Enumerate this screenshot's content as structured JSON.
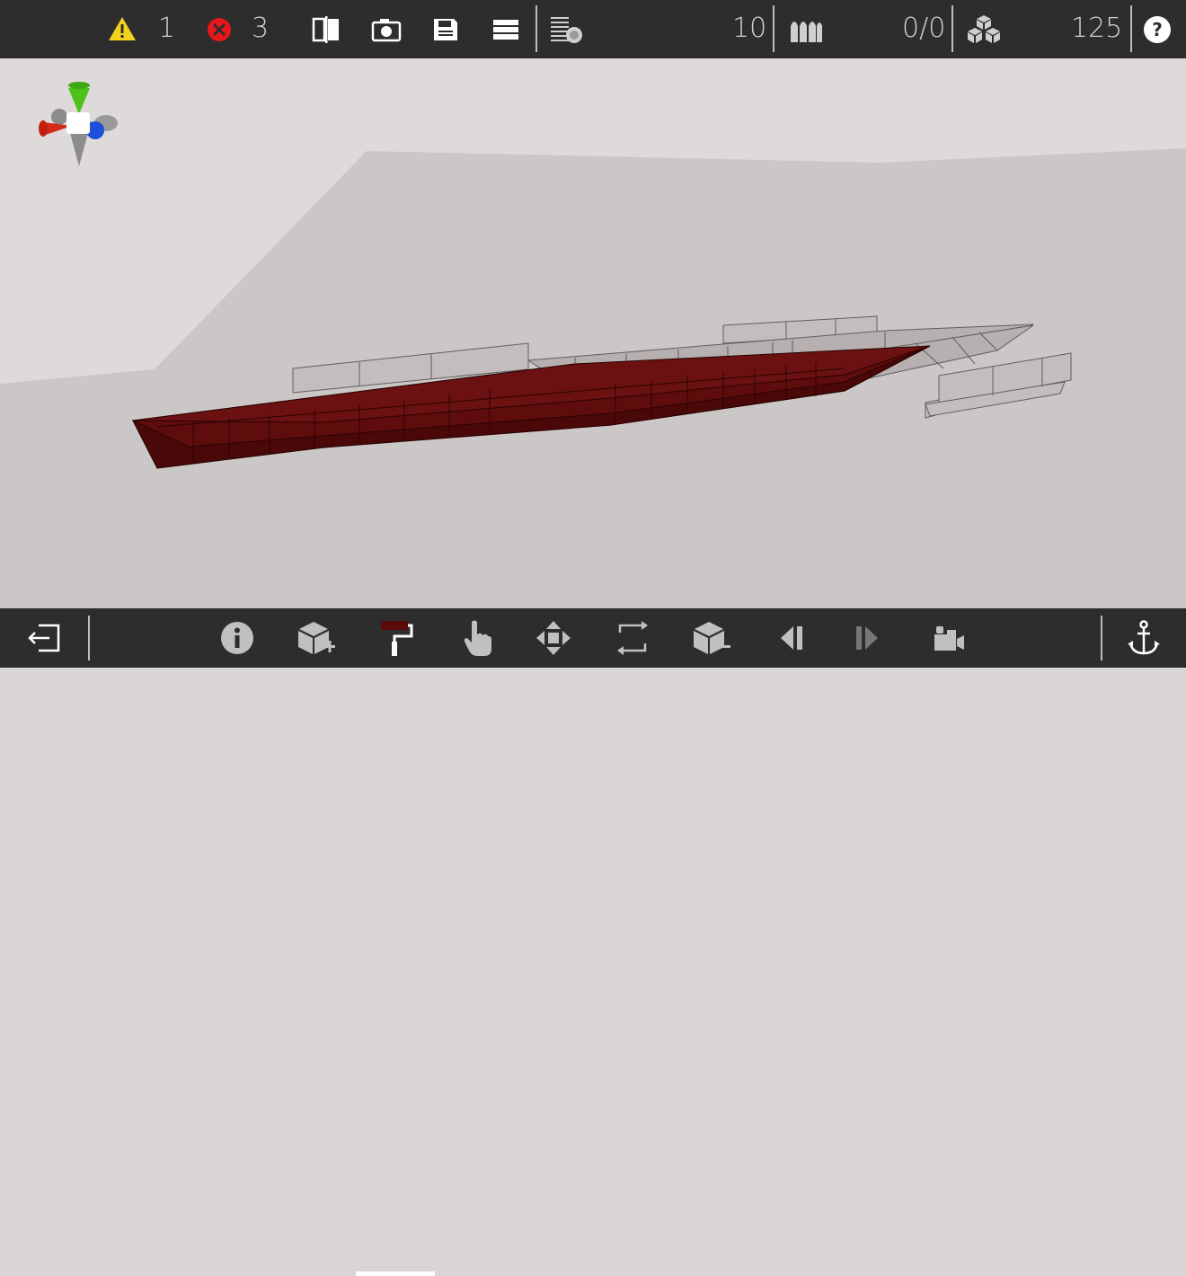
{
  "topbar": {
    "warnings_count": "1",
    "errors_count": "3",
    "ammo_count": "10",
    "ratio_count": "0/0",
    "blocks_count": "125",
    "icons": {
      "warning": "warning-icon",
      "error": "error-icon",
      "split_view": "split-view-icon",
      "screenshot": "camera-icon",
      "save": "save-icon",
      "menu": "menu-icon",
      "layers": "layers-icon",
      "ammo": "ammo-icon",
      "blocks": "blocks-icon",
      "help": "help-icon"
    }
  },
  "bottombar": {
    "tools": [
      "exit",
      "info",
      "add-block",
      "paint",
      "select",
      "move",
      "rotate",
      "remove-block",
      "undo",
      "redo",
      "camera-tool",
      "anchor"
    ],
    "active_tool": "paint",
    "paint_color": "#5a0a0a"
  },
  "colors": {
    "accent_red": "#e8171b",
    "warning_yellow": "#f2d21d",
    "hull_dark_red": "#5b0c0c",
    "bar_bg": "#2d2d2d"
  }
}
